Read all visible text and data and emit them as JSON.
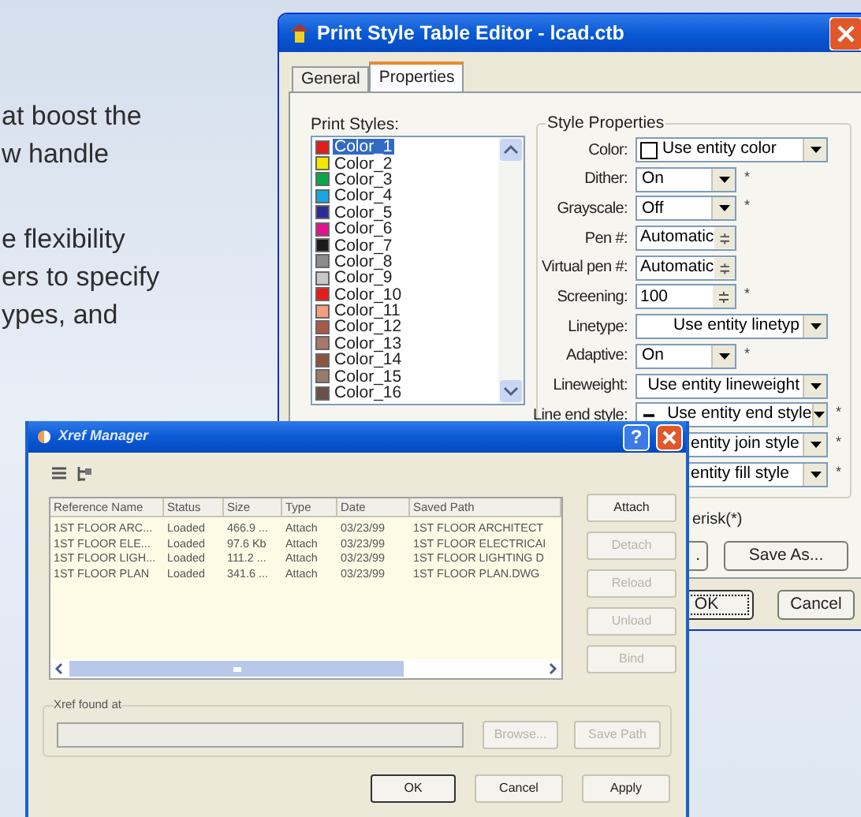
{
  "intro_text": {
    "paragraphs": [
      [
        "at boost the",
        "w handle"
      ],
      [
        "e flexibility",
        "ers to specify",
        "ypes, and"
      ]
    ]
  },
  "print_style_editor": {
    "title": "Print Style Table Editor - lcad.ctb",
    "tabs": [
      {
        "label": "General",
        "selected": false
      },
      {
        "label": "Properties",
        "selected": true
      }
    ],
    "print_styles": {
      "label": "Print Styles:",
      "items": [
        {
          "name": "Color_1",
          "color": "#e41b1b",
          "selected": true
        },
        {
          "name": "Color_2",
          "color": "#f5e800",
          "selected": false
        },
        {
          "name": "Color_3",
          "color": "#0aa64a",
          "selected": false
        },
        {
          "name": "Color_4",
          "color": "#1aa6e0",
          "selected": false
        },
        {
          "name": "Color_5",
          "color": "#2b2b96",
          "selected": false
        },
        {
          "name": "Color_6",
          "color": "#e0148c",
          "selected": false
        },
        {
          "name": "Color_7",
          "color": "#1a1a1a",
          "selected": false
        },
        {
          "name": "Color_8",
          "color": "#8c8c8c",
          "selected": false
        },
        {
          "name": "Color_9",
          "color": "#c8c8c8",
          "selected": false
        },
        {
          "name": "Color_10",
          "color": "#e81c1c",
          "selected": false
        },
        {
          "name": "Color_11",
          "color": "#f2a080",
          "selected": false
        },
        {
          "name": "Color_12",
          "color": "#a85a48",
          "selected": false
        },
        {
          "name": "Color_13",
          "color": "#a8786a",
          "selected": false
        },
        {
          "name": "Color_14",
          "color": "#8c5440",
          "selected": false
        },
        {
          "name": "Color_15",
          "color": "#9a7a6c",
          "selected": false
        },
        {
          "name": "Color_16",
          "color": "#6a5046",
          "selected": false
        }
      ]
    },
    "style_properties": {
      "title": "Style Properties",
      "rows": [
        {
          "kind": "swatch",
          "label": "Color:",
          "value": "Use entity color"
        },
        {
          "kind": "dropdown",
          "label": "Dither:",
          "value": "On",
          "note": "*"
        },
        {
          "kind": "dropdown",
          "label": "Grayscale:",
          "value": "Off",
          "note": "*"
        },
        {
          "kind": "spin",
          "label": "Pen #:",
          "value": "Automatic"
        },
        {
          "kind": "spin",
          "label": "Virtual pen #:",
          "value": "Automatic"
        },
        {
          "kind": "spin",
          "label": "Screening:",
          "value": "100",
          "note": "*"
        },
        {
          "kind": "wide",
          "label": "Linetype:",
          "value": "Use entity linetyp"
        },
        {
          "kind": "dropdown",
          "label": "Adaptive:",
          "value": "On",
          "note": "*"
        },
        {
          "kind": "wide",
          "label": "Lineweight:",
          "value": "Use entity lineweight"
        },
        {
          "kind": "line",
          "label": "Line end style:",
          "value": "Use entity end style",
          "note": "*"
        },
        {
          "kind": "covered",
          "value": "entity join style",
          "note": "*"
        },
        {
          "kind": "covered",
          "value": "entity fill style",
          "note": "*"
        }
      ]
    },
    "footnote": "erisk(*)",
    "buttons": [
      {
        "label": "."
      },
      {
        "label": "Save As..."
      }
    ],
    "dialog_buttons": [
      {
        "label": "OK",
        "default": true
      },
      {
        "label": "Cancel",
        "default": false
      }
    ]
  },
  "xref_manager": {
    "title": "Xref Manager",
    "help": "?",
    "columns": [
      "Reference Name",
      "Status",
      "Size",
      "Type",
      "Date",
      "Saved Path"
    ],
    "rows": [
      [
        "1ST FLOOR ARC...",
        "Loaded",
        "466.9 ...",
        "Attach",
        "03/23/99",
        "1ST FLOOR ARCHITECT"
      ],
      [
        "1ST FLOOR ELE...",
        "Loaded",
        "97.6 Kb",
        "Attach",
        "03/23/99",
        "1ST FLOOR ELECTRICAI"
      ],
      [
        "1ST FLOOR LIGH...",
        "Loaded",
        "111.2 ...",
        "Attach",
        "03/23/99",
        "1ST FLOOR LIGHTING D"
      ],
      [
        "1ST FLOOR PLAN",
        "Loaded",
        "341.6 ...",
        "Attach",
        "03/23/99",
        "1ST FLOOR PLAN.DWG"
      ]
    ],
    "side_buttons": [
      {
        "label": "Attach",
        "disabled": false
      },
      {
        "label": "Detach",
        "disabled": true
      },
      {
        "label": "Reload",
        "disabled": true
      },
      {
        "label": "Unload",
        "disabled": true
      },
      {
        "label": "Bind",
        "disabled": true
      }
    ],
    "found_label": "Xref found at",
    "path_buttons": [
      {
        "label": "Browse...",
        "disabled": true
      },
      {
        "label": "Save Path",
        "disabled": true
      }
    ],
    "dialog_buttons": [
      {
        "label": "OK",
        "default": true
      },
      {
        "label": "Cancel",
        "default": false
      },
      {
        "label": "Apply",
        "default": false
      }
    ]
  }
}
